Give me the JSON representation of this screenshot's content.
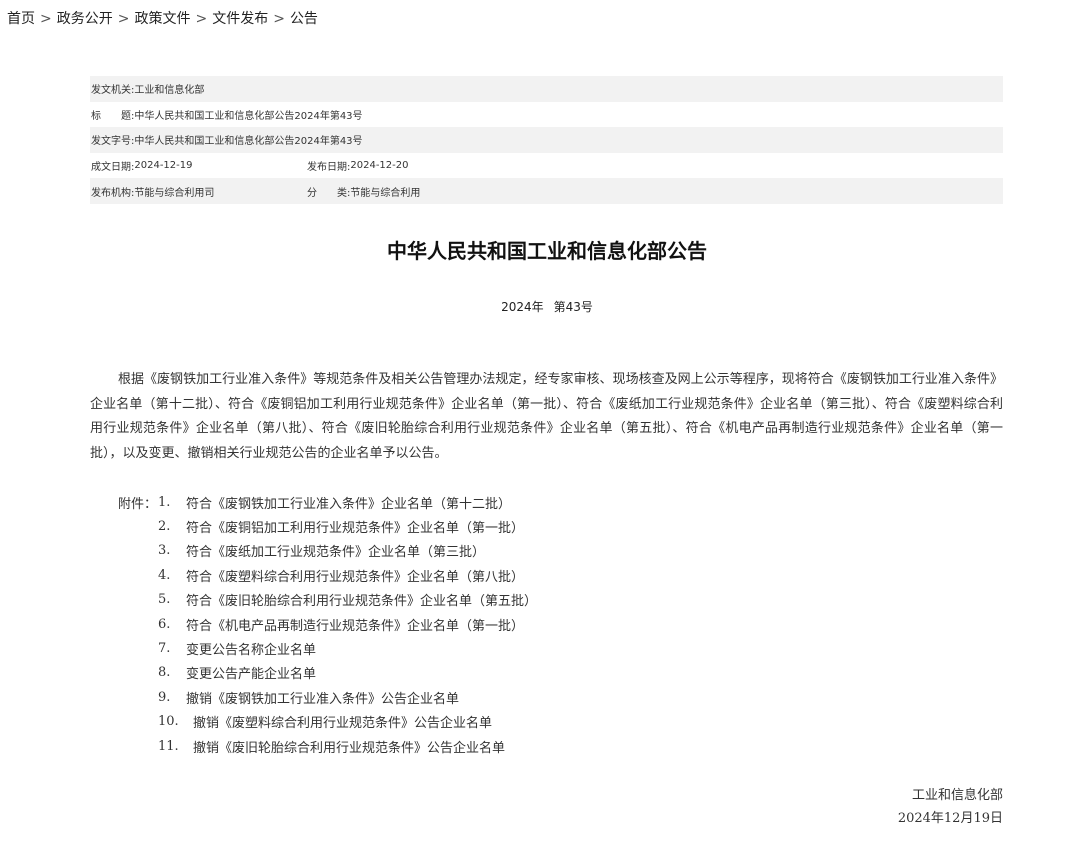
{
  "breadcrumb": {
    "items": [
      "首页",
      "政务公开",
      "政策文件",
      "文件发布",
      "公告"
    ],
    "separator": ">"
  },
  "meta": {
    "issuer_label": "发文机关:",
    "issuer": "工业和信息化部",
    "title_label": "标　　题:",
    "title": "中华人民共和国工业和信息化部公告2024年第43号",
    "docnum_label": "发文字号:",
    "docnum": "中华人民共和国工业和信息化部公告2024年第43号",
    "written_label": "成文日期:",
    "written": "2024-12-19",
    "published_label": "发布日期:",
    "published": "2024-12-20",
    "org_label": "发布机构:",
    "org": "节能与综合利用司",
    "category_label": "分　　类:",
    "category": "节能与综合利用"
  },
  "document": {
    "title": "中华人民共和国工业和信息化部公告",
    "year": "2024年",
    "number": "第43号",
    "body": "根据《废钢铁加工行业准入条件》等规范条件及相关公告管理办法规定，经专家审核、现场核查及网上公示等程序，现将符合《废钢铁加工行业准入条件》企业名单（第十二批）、符合《废铜铝加工利用行业规范条件》企业名单（第一批）、符合《废纸加工行业规范条件》企业名单（第三批）、符合《废塑料综合利用行业规范条件》企业名单（第八批）、符合《废旧轮胎综合利用行业规范条件》企业名单（第五批）、符合《机电产品再制造行业规范条件》企业名单（第一批），以及变更、撤销相关行业规范公告的企业名单予以公告。",
    "attachments_label": "附件：",
    "attachments": [
      {
        "num": "1.",
        "text": "符合《废钢铁加工行业准入条件》企业名单（第十二批）"
      },
      {
        "num": "2.",
        "text": "符合《废铜铝加工利用行业规范条件》企业名单（第一批）"
      },
      {
        "num": "3.",
        "text": "符合《废纸加工行业规范条件》企业名单（第三批）"
      },
      {
        "num": "4.",
        "text": "符合《废塑料综合利用行业规范条件》企业名单（第八批）"
      },
      {
        "num": "5.",
        "text": "符合《废旧轮胎综合利用行业规范条件》企业名单（第五批）"
      },
      {
        "num": "6.",
        "text": "符合《机电产品再制造行业规范条件》企业名单（第一批）"
      },
      {
        "num": "7.",
        "text": "变更公告名称企业名单"
      },
      {
        "num": "8.",
        "text": "变更公告产能企业名单"
      },
      {
        "num": "9.",
        "text": "撤销《废钢铁加工行业准入条件》公告企业名单"
      },
      {
        "num": "10.",
        "text": "撤销《废塑料综合利用行业规范条件》公告企业名单"
      },
      {
        "num": "11.",
        "text": "撤销《废旧轮胎综合利用行业规范条件》公告企业名单"
      }
    ],
    "signer": "工业和信息化部",
    "sign_date": "2024年12月19日"
  }
}
